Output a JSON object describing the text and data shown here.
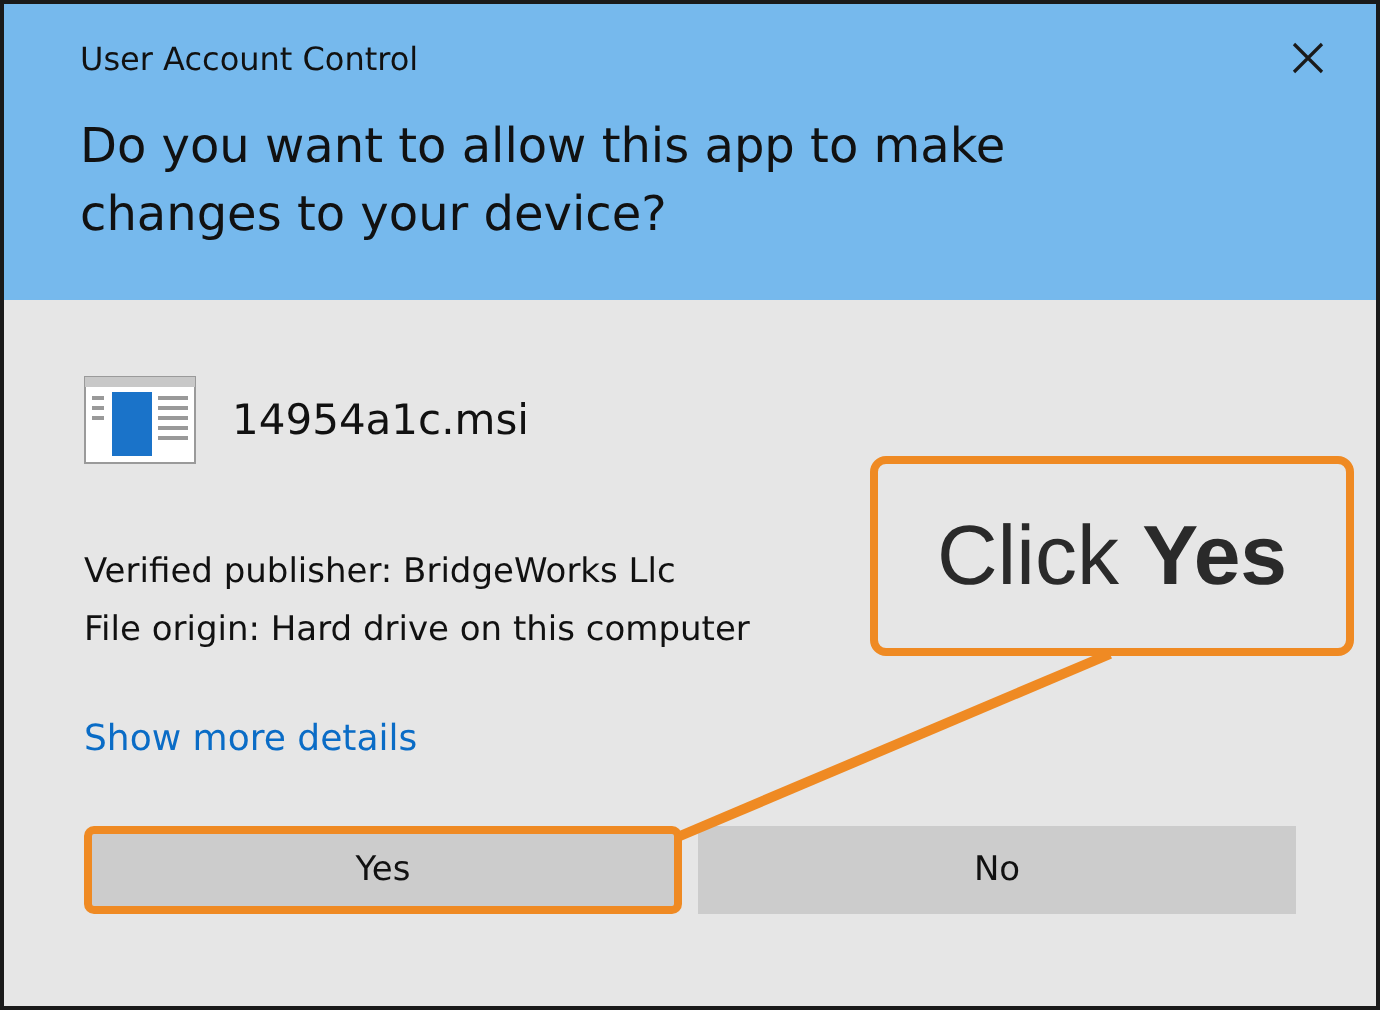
{
  "window": {
    "title": "User Account Control"
  },
  "heading": "Do you want to allow this app to make changes to your device?",
  "app": {
    "name": "14954a1c.msi"
  },
  "details": [
    "Verified publisher: BridgeWorks Llc",
    "File origin: Hard drive on this computer"
  ],
  "link": "Show more details",
  "buttons": [
    {
      "label": "Yes",
      "highlighted": true
    },
    {
      "label": "No",
      "highlighted": false
    }
  ],
  "callout": {
    "text": "Click **Yes**"
  }
}
